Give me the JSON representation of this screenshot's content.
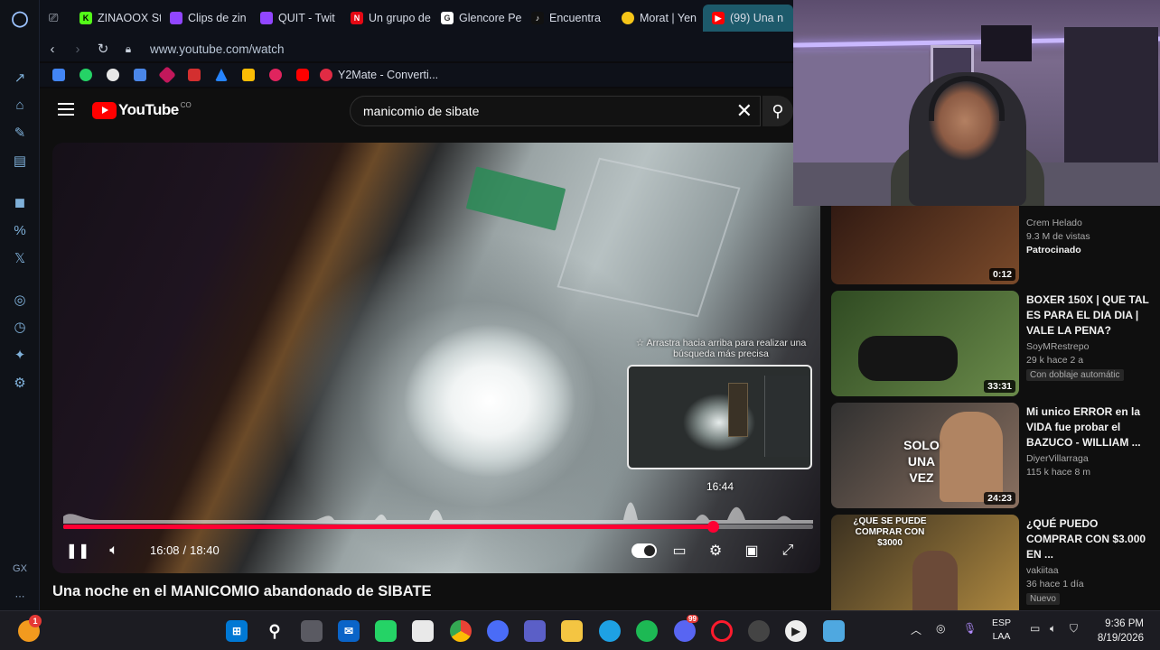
{
  "browser": {
    "tabs": [
      {
        "label": "ZINAOOX St",
        "fav_color": "#53fc18",
        "fav_letter": "K"
      },
      {
        "label": "Clips de zin",
        "fav_color": "#9146ff",
        "fav_letter": ""
      },
      {
        "label": "QUIT - Twit",
        "fav_color": "#9146ff",
        "fav_letter": ""
      },
      {
        "label": "Un grupo de",
        "fav_color": "#e50914",
        "fav_letter": "N"
      },
      {
        "label": "Glencore Pe",
        "fav_color": "#ffffff",
        "fav_letter": "G"
      },
      {
        "label": "Encuentra",
        "fav_color": "#111111",
        "fav_letter": "♪"
      },
      {
        "label": "Morat | Yen",
        "fav_color": "#f5c518",
        "fav_letter": ""
      },
      {
        "label": "(99) Una n",
        "fav_color": "#ff0000",
        "fav_letter": "▶",
        "active": true
      }
    ],
    "url": "www.youtube.com/watch",
    "bookmark_text": "Y2Mate - Converti..."
  },
  "youtube": {
    "logo_text": "YouTube",
    "country": "CO",
    "search_query": "manicomio de sibate",
    "player": {
      "seek_tip": "☆ Arrastra hacia arriba para realizar una búsqueda más precisa",
      "preview_time": "16:44",
      "current_time": "16:08",
      "duration": "18:40",
      "progress": 0.866,
      "hover_progress": 0.896
    },
    "video_title": "Una noche en el MANICOMIO abandonado de SIBATE"
  },
  "recommendations": [
    {
      "title": "",
      "channel": "Crem Helado",
      "meta": "9.3 M de vistas",
      "extra": "Patrocinado",
      "duration": "0:12",
      "thumb_colors": [
        "#2a1510",
        "#7a4a2a"
      ]
    },
    {
      "title": "BOXER 150X | QUE TAL ES PARA EL DIA DIA | VALE LA PENA?",
      "channel": "SoyMRestrepo",
      "meta": "29 k   hace 2 a",
      "badge": "Con doblaje automátic",
      "duration": "33:31",
      "thumb_colors": [
        "#2f4a22",
        "#6a8a4a"
      ]
    },
    {
      "title": "Mi unico ERROR en la VIDA fue probar el BAZUCO - WILLIAM ...",
      "channel": "DiyerVillarraga",
      "meta": "115 k   hace 8 m",
      "duration": "24:23",
      "thumb_colors": [
        "#303030",
        "#8a7060"
      ],
      "overlay": "SOLO UNA VEZ"
    },
    {
      "title": "¿QUÉ PUEDO COMPRAR CON $3.000 EN ...",
      "channel": "vakiitaa",
      "meta": "36   hace 1 día",
      "badge": "Nuevo",
      "duration": "",
      "thumb_colors": [
        "#3a3020",
        "#b08a40"
      ],
      "overlay": "¿QUE SE PUEDE COMPRAR CON $3000"
    }
  ],
  "taskbar": {
    "lang_top": "ESP",
    "lang_bottom": "LAA",
    "time": "9:36 PM",
    "date": "8/19/2026",
    "badge_count": "1",
    "discord_badge": "99"
  },
  "colors": {
    "accent_red": "#ff0033",
    "youtube_red": "#ff0000",
    "active_tab": "#1d5a6b"
  }
}
